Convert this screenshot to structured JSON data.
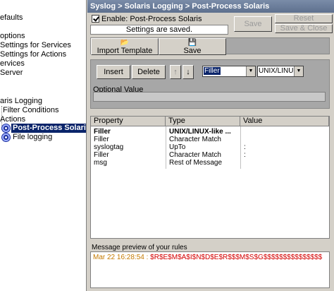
{
  "tree": {
    "items": [
      {
        "label": "efaults"
      },
      {
        "label": " options"
      },
      {
        "label": "Settings for Services"
      },
      {
        "label": "Settings for Actions"
      },
      {
        "label": "ervices"
      },
      {
        "label": "Server"
      },
      {
        "label": "aris Logging"
      },
      {
        "label": "Filter Conditions"
      },
      {
        "label": "Actions"
      },
      {
        "label": "Post-Process Solaris"
      },
      {
        "label": "File logging"
      }
    ]
  },
  "header": {
    "title": "Syslog > Solaris Logging > Post-Process Solaris"
  },
  "enable": {
    "label": "Enable: Post-Process Solaris"
  },
  "status": {
    "text": "Settings are saved."
  },
  "buttons": {
    "save": "Save",
    "reset": "Reset",
    "save_close": "Save & Close",
    "import_template": "Import Template",
    "save_big": "Save",
    "insert": "Insert",
    "delete": "Delete",
    "up": "↑",
    "down": "↓"
  },
  "selects": {
    "property": "Filler",
    "type": "UNIX/LINUX-lik"
  },
  "optional": {
    "label": "Optional Value"
  },
  "table": {
    "headers": [
      "Property",
      "Type",
      "Value"
    ],
    "rows": [
      {
        "property": "Filler",
        "type": "UNIX/LINUX-like ...",
        "value": ""
      },
      {
        "property": "Filler",
        "type": "Character Match",
        "value": ""
      },
      {
        "property": "syslogtag",
        "type": "UpTo",
        "value": ":"
      },
      {
        "property": "Filler",
        "type": "Character Match",
        "value": ":"
      },
      {
        "property": "msg",
        "type": "Rest of Message",
        "value": ""
      }
    ]
  },
  "preview": {
    "label": "Message preview of your rules",
    "time": "Mar 22 16:28:54 :",
    "text": "$R$E$M$A$I$N$D$E$R$$$M$S$G$$$$$$$$$$$$$$$"
  },
  "colors": {
    "selection": "#0a246a",
    "titlebar": "#6b7d99",
    "preview_time": "#c47a00",
    "preview_text": "#d40000"
  }
}
